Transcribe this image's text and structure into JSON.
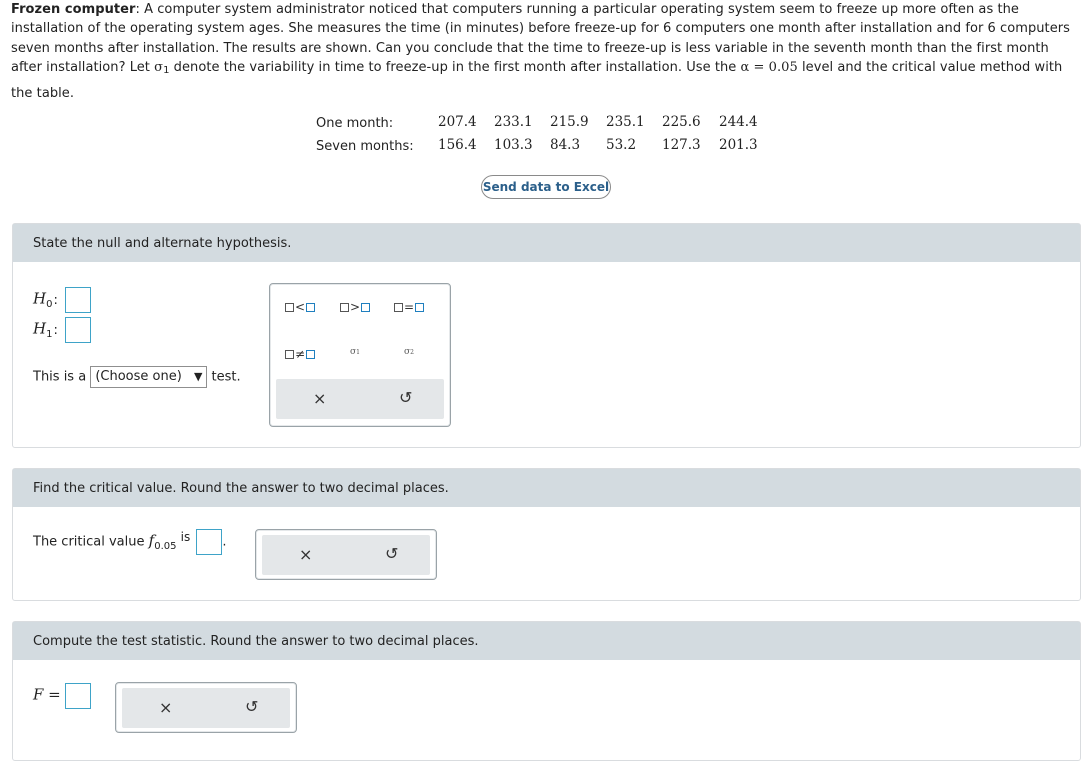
{
  "problem": {
    "title": "Frozen computer",
    "line1": ": A computer system administrator noticed that computers running a particular operating system seem to freeze up more often as the",
    "line2": "installation of the operating system ages. She measures the time (in minutes) before freeze-up for 6 computers one month after installation and for 6 computers",
    "line3": "seven months after installation. The results are shown. Can you conclude that the time to freeze-up is less variable in the seventh month than the first month",
    "line4a": "after installation? Let ",
    "sigma": "σ",
    "sigma_sub": "1",
    "line4b": " denote the variability in time to freeze-up in the first month after installation. Use the ",
    "alpha_expr": "α = 0.05",
    "line4c": " level and the critical value method with",
    "line5": "the table."
  },
  "data_table": {
    "rows": [
      {
        "label": "One month:",
        "values": [
          "207.4",
          "233.1",
          "215.9",
          "235.1",
          "225.6",
          "244.4"
        ]
      },
      {
        "label": "Seven months:",
        "values": [
          "156.4",
          "103.3",
          "84.3",
          "53.2",
          "127.3",
          "201.3"
        ]
      }
    ]
  },
  "excel_button": "Send data to Excel",
  "section1": {
    "header": "State the null and alternate hypothesis.",
    "h0": "H",
    "h0_sub": "0",
    "h1": "H",
    "h1_sub": "1",
    "colon": ":",
    "test_prefix": "This is a",
    "test_select": "(Choose one)",
    "test_suffix": "test.",
    "palette": {
      "lt": "<",
      "gt": ">",
      "eq": "=",
      "neq": "≠",
      "sigma1": "σ",
      "sigma1_sub": "1",
      "sigma2": "σ",
      "sigma2_sub": "2"
    }
  },
  "section2": {
    "header": "Find the critical value. Round the answer to two decimal places.",
    "text_prefix": "The critical value",
    "f": "f",
    "f_sub": "0.05",
    "text_suffix": "is",
    "period": "."
  },
  "section3": {
    "header": "Compute the test statistic. Round the answer to two decimal places.",
    "label": "F ="
  },
  "icons": {
    "clear": "×",
    "undo": "↺"
  },
  "colors": {
    "section_header_bg": "#d3dbe0",
    "input_border": "#3ea3c8",
    "excel_text": "#2b5f8a"
  }
}
